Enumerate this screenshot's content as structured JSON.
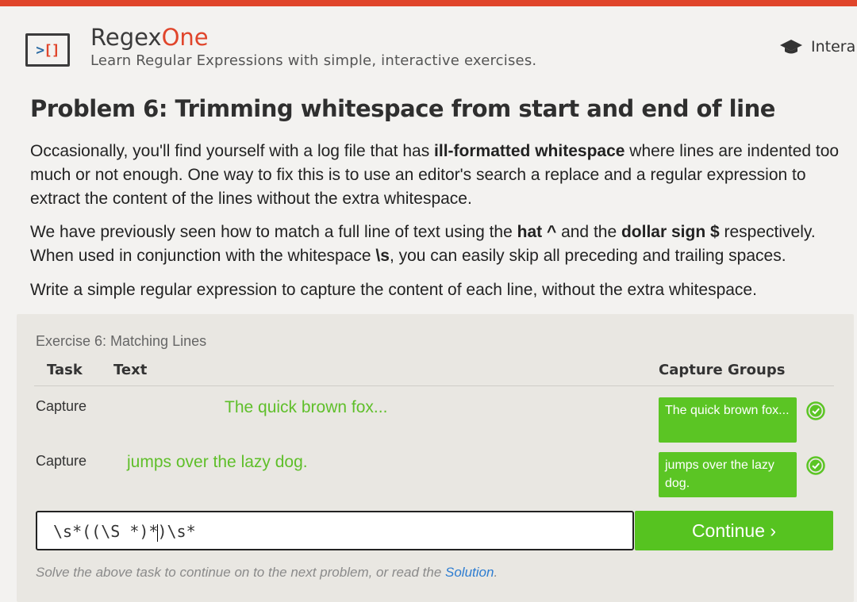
{
  "colors": {
    "accent": "#e0452b",
    "success": "#5bc524",
    "link": "#2e7dd1"
  },
  "header": {
    "brand_first": "Regex",
    "brand_second": "One",
    "tagline": "Learn Regular Expressions with simple, interactive exercises.",
    "nav_label": "Intera",
    "nav_icon": "graduation-cap-icon",
    "logo_glyph_left": ">",
    "logo_glyph_right": "[]"
  },
  "problem": {
    "title": "Problem 6: Trimming whitespace from start and end of line",
    "p1": {
      "a": "Occasionally, you'll find yourself with a log file that has ",
      "bold": "ill-formatted whitespace",
      "b": " where lines are indented too much or not enough. One way to fix this is to use an editor's search a replace and a regular expression to extract the content of the lines without the extra whitespace."
    },
    "p2": {
      "a": "We have previously seen how to match a full line of text using the ",
      "hat": "hat ^",
      "b": " and the ",
      "dollar": "dollar sign $",
      "c": " respectively. When used in conjunction with the whitespace ",
      "ws": "\\s",
      "d": ", you can easily skip all preceding and trailing spaces."
    },
    "p3": "Write a simple regular expression to capture the content of each line, without the extra whitespace."
  },
  "exercise": {
    "title": "Exercise 6: Matching Lines",
    "columns": {
      "task": "Task",
      "text": "Text",
      "groups": "Capture Groups"
    },
    "rows": [
      {
        "task": "Capture",
        "text": "The quick brown fox...",
        "group": "The quick brown fox...",
        "status": "check-circle-icon"
      },
      {
        "task": "Capture",
        "text": "jumps over the lazy dog.",
        "group": "jumps over the lazy dog.",
        "status": "check-circle-icon"
      }
    ],
    "input_before_caret": "\\s*((\\S *)*",
    "input_after_caret": ")\\s*",
    "continue_label": "Continue ›",
    "hint_text": "Solve the above task to continue on to the next problem, or read the ",
    "hint_link": "Solution",
    "hint_end": "."
  }
}
